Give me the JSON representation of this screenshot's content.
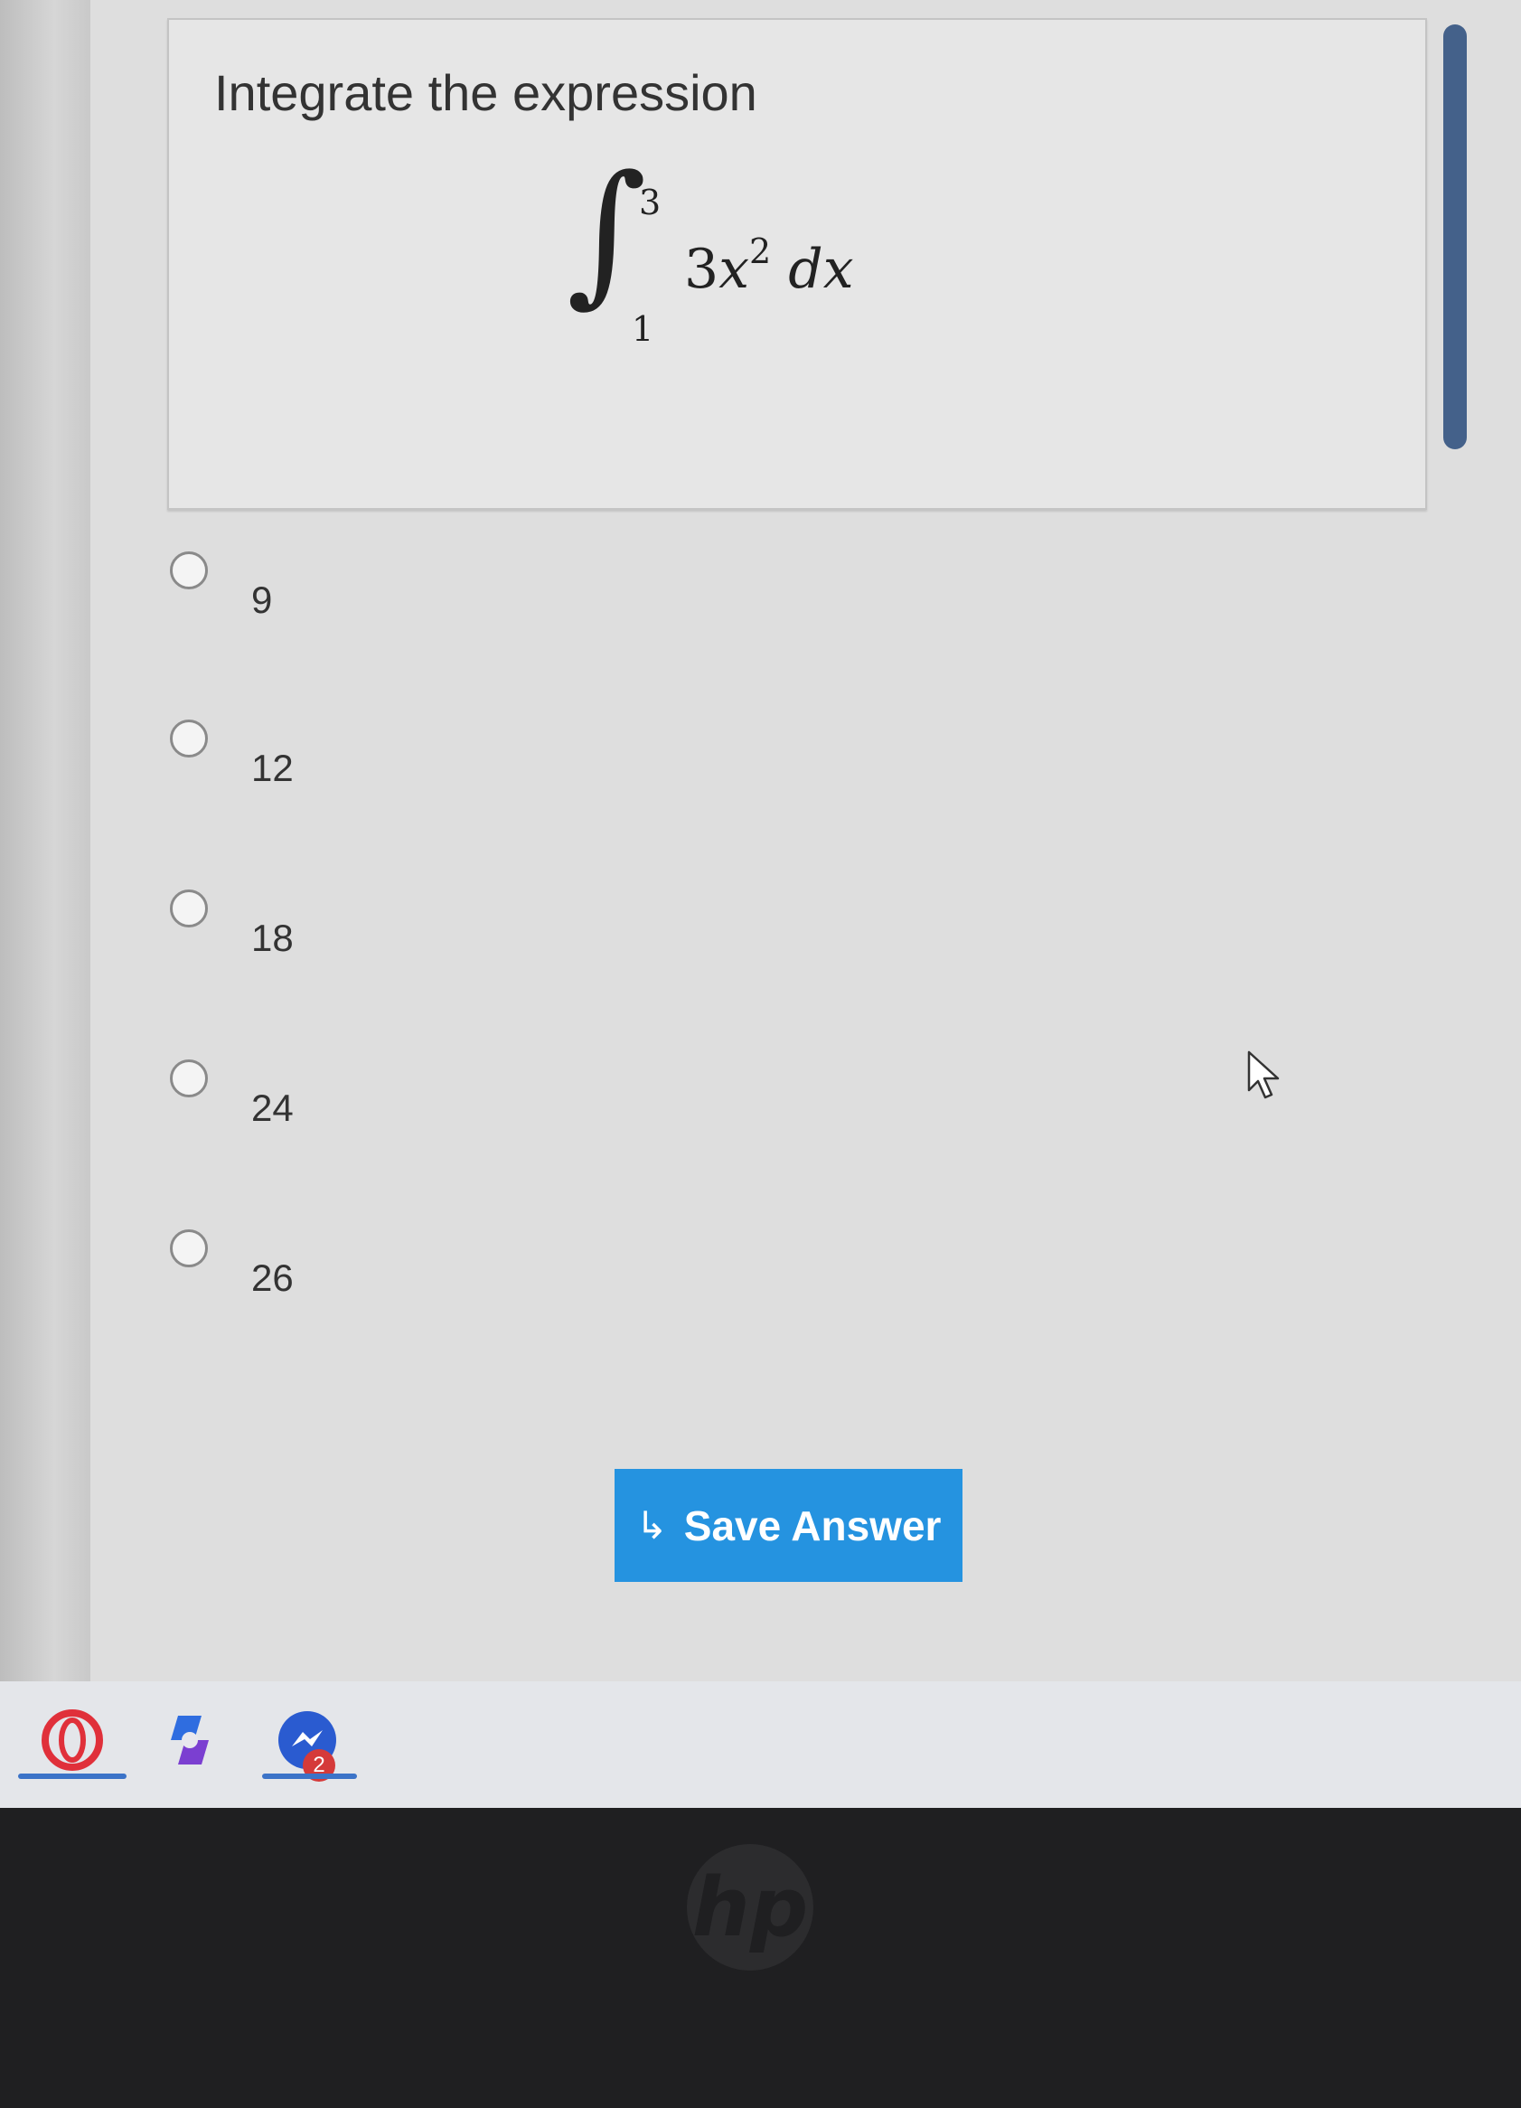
{
  "question": {
    "prompt": "Integrate the expression",
    "formula": {
      "upper_limit": "3",
      "lower_limit": "1",
      "coefficient": "3",
      "variable": "x",
      "exponent": "2",
      "differential": "dx"
    }
  },
  "options": [
    {
      "label": "9"
    },
    {
      "label": "12"
    },
    {
      "label": "18"
    },
    {
      "label": "24"
    },
    {
      "label": "26"
    }
  ],
  "save_button": {
    "icon": "return-arrow-icon",
    "arrow_glyph": "↳",
    "label": "Save Answer",
    "color": "#2593e0"
  },
  "taskbar": {
    "badge_count": "2",
    "icons": [
      "opera-icon",
      "copilot-icon",
      "messenger-icon"
    ]
  },
  "colors": {
    "accent": "#2593e0",
    "scrollbar": "#44618a"
  },
  "bezel": {
    "logo": "hp"
  }
}
